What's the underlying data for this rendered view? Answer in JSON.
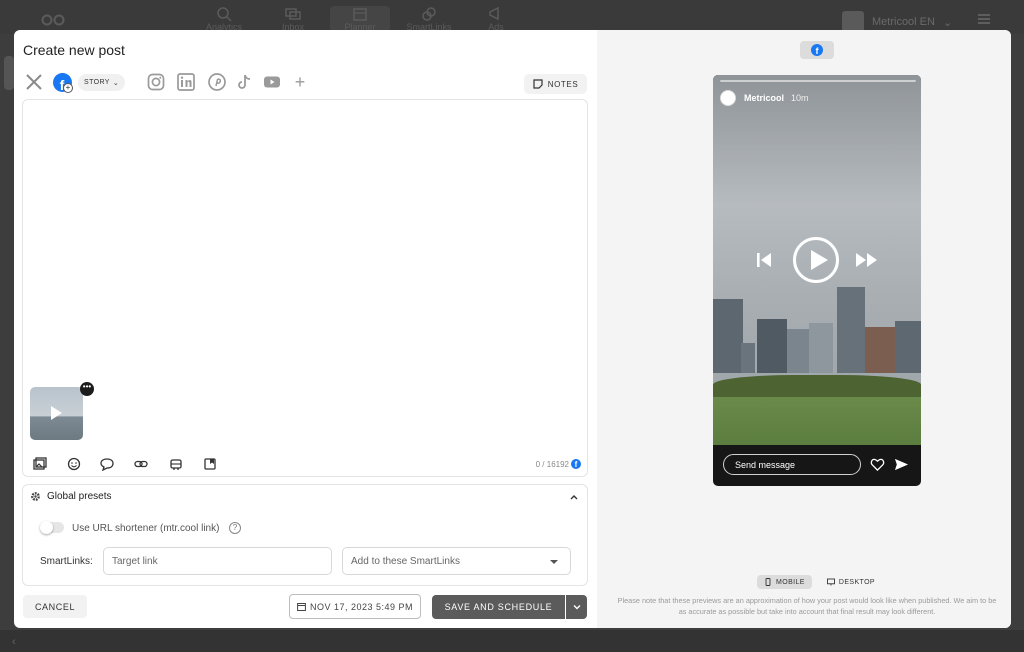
{
  "background": {
    "nav": [
      "Analytics",
      "Inbox",
      "Planner",
      "SmartLinks",
      "Ads"
    ],
    "account_name": "Metricool EN"
  },
  "modal": {
    "title": "Create new post",
    "networks": [
      "x-icon",
      "facebook-icon",
      "instagram-icon",
      "linkedin-icon",
      "pinterest-icon",
      "tiktok-icon",
      "youtube-icon",
      "plus-icon"
    ],
    "story_label": "STORY",
    "notes_label": "NOTES",
    "char_count": "0 / 16192",
    "global_presets": {
      "title": "Global presets",
      "url_shortener_label": "Use URL shortener (mtr.cool link)",
      "smartlinks_label": "SmartLinks:",
      "target_link_placeholder": "Target link",
      "add_smartlinks_placeholder": "Add to these SmartLinks"
    },
    "cancel_label": "CANCEL",
    "date_label": "NOV 17, 2023 5:49 PM",
    "save_label": "SAVE AND SCHEDULE"
  },
  "preview": {
    "username": "Metricool",
    "time_ago": "10m",
    "send_message_placeholder": "Send message",
    "mobile_label": "MOBILE",
    "desktop_label": "DESKTOP",
    "disclaimer": "Please note that these previews are an approximation of how your post would look like when published. We aim to be as accurate as possible but take into account that final result may look different."
  },
  "colors": {
    "facebook_blue": "#1877f2",
    "primary_button": "#5b5b5b",
    "overlay": "#3d3d3d"
  }
}
